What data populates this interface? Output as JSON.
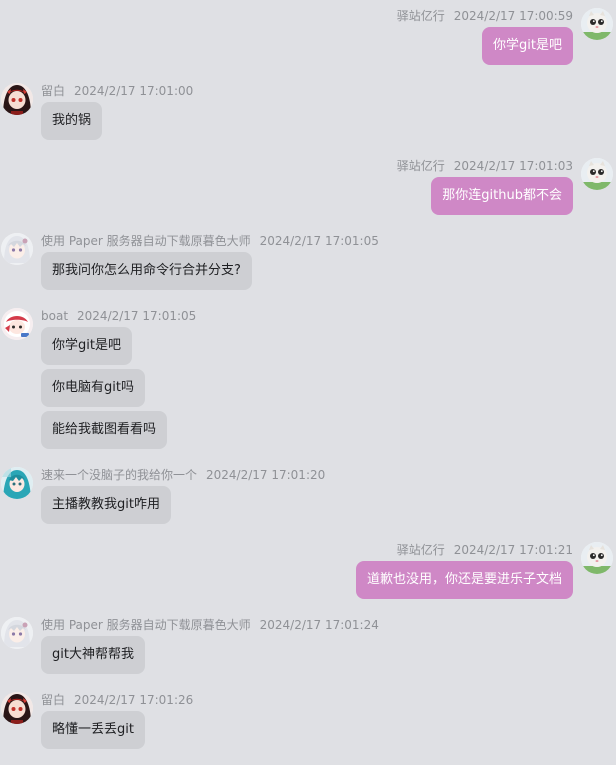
{
  "chat": {
    "messages": [
      {
        "side": "right",
        "avatar": "kitten-avatar",
        "name": "驿站亿行",
        "time": "2024/2/17 17:00:59",
        "texts": [
          "你学git是吧"
        ]
      },
      {
        "side": "left",
        "avatar": "red-hair-girl-avatar",
        "name": "留白",
        "time": "2024/2/17 17:01:00",
        "texts": [
          "我的锅"
        ]
      },
      {
        "side": "right",
        "avatar": "kitten-avatar",
        "name": "驿站亿行",
        "time": "2024/2/17 17:01:03",
        "texts": [
          "那你连github都不会"
        ]
      },
      {
        "side": "left",
        "avatar": "white-hair-girl-avatar",
        "name": "使用 Paper 服务器自动下载原暮色大师",
        "time": "2024/2/17 17:01:05",
        "texts": [
          "那我问你怎么用命令行合并分支?"
        ]
      },
      {
        "side": "left",
        "avatar": "boat-avatar",
        "name": "boat",
        "time": "2024/2/17 17:01:05",
        "texts": [
          "你学git是吧",
          "你电脑有git吗",
          "能给我截图看看吗"
        ]
      },
      {
        "side": "left",
        "avatar": "teal-hair-girl-avatar",
        "name": "速来一个没脑子的我给你一个",
        "time": "2024/2/17 17:01:20",
        "texts": [
          "主播教教我git咋用"
        ]
      },
      {
        "side": "right",
        "avatar": "kitten-avatar",
        "name": "驿站亿行",
        "time": "2024/2/17 17:01:21",
        "texts": [
          "道歉也没用，你还是要进乐子文档"
        ]
      },
      {
        "side": "left",
        "avatar": "white-hair-girl-avatar",
        "name": "使用 Paper 服务器自动下载原暮色大师",
        "time": "2024/2/17 17:01:24",
        "texts": [
          "git大神帮帮我"
        ]
      },
      {
        "side": "left",
        "avatar": "red-hair-girl-avatar",
        "name": "留白",
        "time": "2024/2/17 17:01:26",
        "texts": [
          "略懂一丢丢git"
        ]
      }
    ]
  }
}
